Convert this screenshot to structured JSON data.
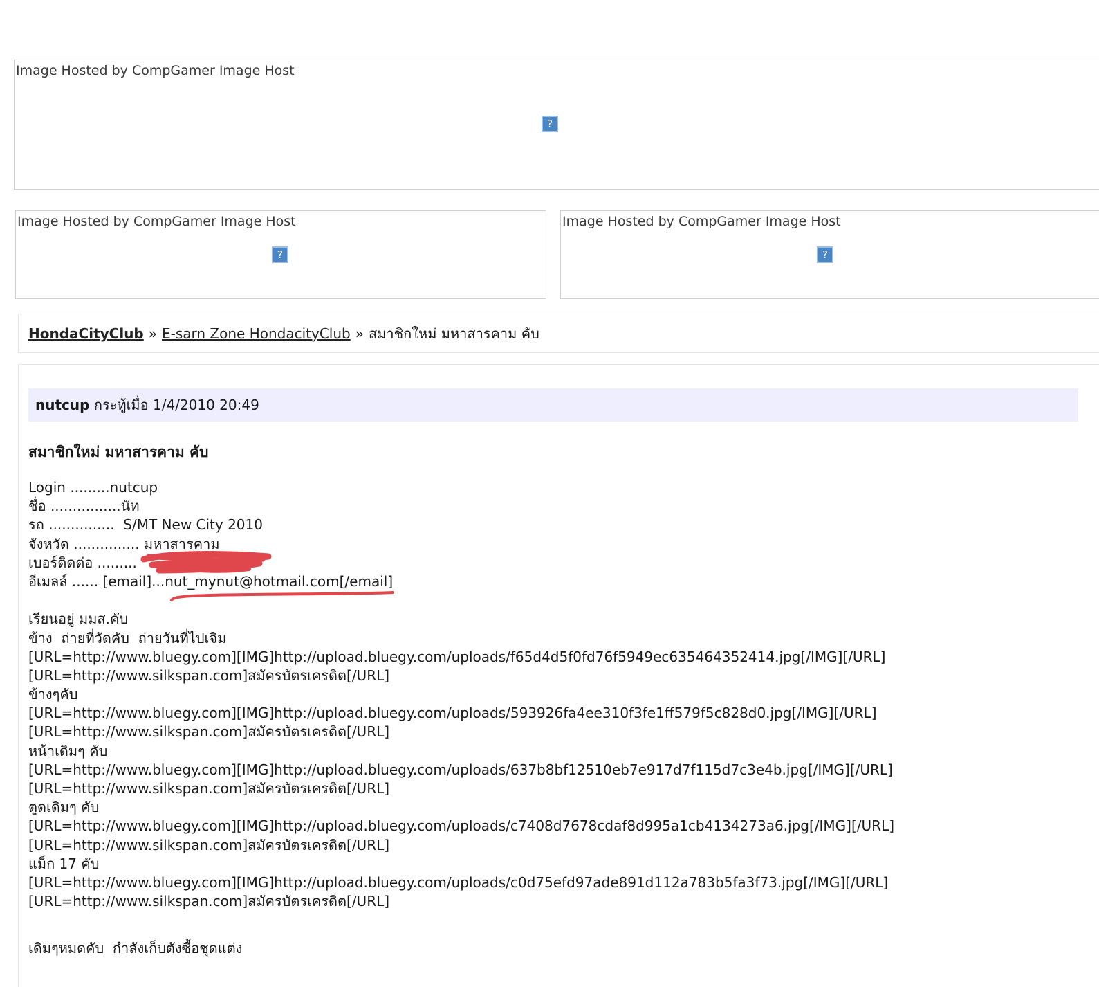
{
  "image_boxes": [
    {
      "alt": "Image Hosted by CompGamer Image Host",
      "icon": "broken-image-icon",
      "icon_glyph": "?"
    },
    {
      "alt": "Image Hosted by CompGamer Image Host",
      "icon": "broken-image-icon",
      "icon_glyph": "?"
    },
    {
      "alt": "Image Hosted by CompGamer Image Host",
      "icon": "broken-image-icon",
      "icon_glyph": "?"
    }
  ],
  "breadcrumb": {
    "root": "HondaCityClub",
    "sep": "»",
    "forum": "E-sarn Zone HondacityClub",
    "current": "สมาชิกใหม่ มหาสารคาม คับ"
  },
  "post": {
    "author": "nutcup",
    "meta": "กระทู้เมื่อ 1/4/2010 20:49",
    "title": "สมาชิกใหม่ มหาสารคาม คับ",
    "info_lines": [
      "Login .........nutcup",
      "ชื่อ ................นัท",
      "รถ ...............  S/MT New City 2010",
      "จังหวัด ............... มหาสารคาม",
      "เบอร์ติดต่อ .........",
      "อีเมลล์ ...... [email]...nut_mynut@hotmail.com[/email]"
    ],
    "body_lines": [
      "เรียนอยู่ มมส.คับ",
      "ข้าง  ถ่ายที่วัดคับ  ถ่ายวันที่ไปเจิม",
      "[URL=http://www.bluegy.com][IMG]http://upload.bluegy.com/uploads/f65d4d5f0fd76f5949ec635464352414.jpg[/IMG][/URL]",
      "[URL=http://www.silkspan.com]สมัครบัตรเครดิต[/URL]",
      "ข้างๆคับ",
      "[URL=http://www.bluegy.com][IMG]http://upload.bluegy.com/uploads/593926fa4ee310f3fe1ff579f5c828d0.jpg[/IMG][/URL]",
      "[URL=http://www.silkspan.com]สมัครบัตรเครดิต[/URL]",
      "หน้าเดิมๆ คับ",
      "[URL=http://www.bluegy.com][IMG]http://upload.bluegy.com/uploads/637b8bf12510eb7e917d7f115d7c3e4b.jpg[/IMG][/URL]",
      "[URL=http://www.silkspan.com]สมัครบัตรเครดิต[/URL]",
      "ตูดเดิมๆ คับ",
      "[URL=http://www.bluegy.com][IMG]http://upload.bluegy.com/uploads/c7408d7678cdaf8d995a1cb4134273a6.jpg[/IMG][/URL]",
      "[URL=http://www.silkspan.com]สมัครบัตรเครดิต[/URL]",
      "แม็ก 17 คับ",
      "[URL=http://www.bluegy.com][IMG]http://upload.bluegy.com/uploads/c0d75efd97ade891d112a783b5fa3f73.jpg[/IMG][/URL]",
      "[URL=http://www.silkspan.com]สมัครบัตรเครดิต[/URL]"
    ],
    "closing": "เดิมๆหมดคับ  กำลังเก็บตังซื้อชุดแต่ง"
  },
  "colors": {
    "header_bg": "#eeeeff",
    "annotation_red": "#e0474c",
    "broken_icon": "#4a86c6"
  }
}
